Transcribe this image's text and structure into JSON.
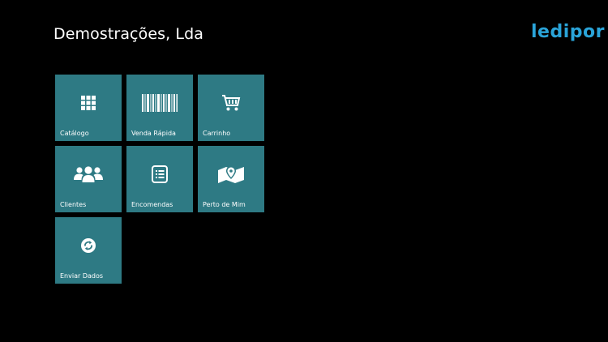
{
  "header": {
    "title": "Demostrações, Lda",
    "logo_text": "ledipor"
  },
  "colors": {
    "background": "#000000",
    "tile": "#2e7a84",
    "logo": "#2aa4d9"
  },
  "tiles": [
    {
      "label": "Catálogo",
      "icon": "grid-icon"
    },
    {
      "label": "Venda Rápida",
      "icon": "barcode-icon"
    },
    {
      "label": "Carrinho",
      "icon": "cart-icon"
    },
    {
      "label": "Clientes",
      "icon": "users-icon"
    },
    {
      "label": "Encomendas",
      "icon": "orders-list-icon"
    },
    {
      "label": "Perto de Mim",
      "icon": "map-pin-icon"
    },
    {
      "label": "Enviar Dados",
      "icon": "sync-icon"
    }
  ]
}
